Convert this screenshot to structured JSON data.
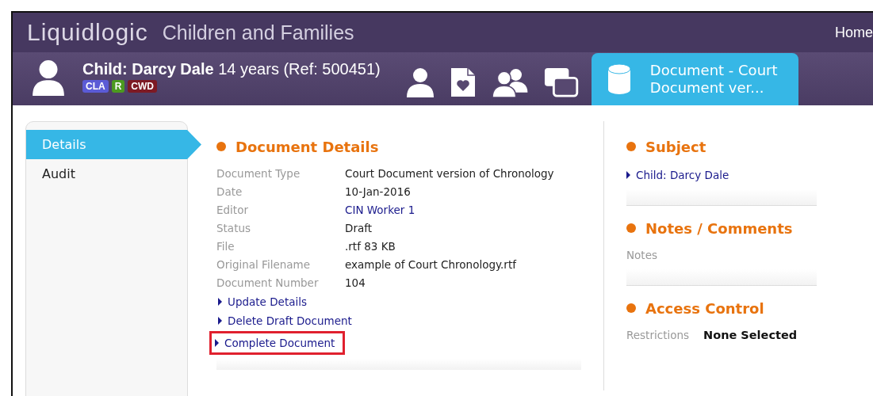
{
  "app_bar": {
    "logo": "Liquidlogic",
    "title": "Children and Families",
    "nav_link": "Home"
  },
  "subject_bar": {
    "name": "Child: Darcy Dale",
    "details": "14 years (Ref: 500451)",
    "badges": [
      {
        "label": "CLA",
        "color": "#5b5bd6"
      },
      {
        "label": "R",
        "color": "#4c9a1f"
      },
      {
        "label": "CWD",
        "color": "#7d1a24"
      }
    ],
    "tabs": [
      {
        "kind": "person",
        "selected": false
      },
      {
        "kind": "document",
        "selected": false
      },
      {
        "kind": "people",
        "selected": false
      },
      {
        "kind": "windows",
        "selected": false
      },
      {
        "kind": "database",
        "label_lines": [
          "Document - Court",
          "Document ver..."
        ],
        "selected": true
      }
    ]
  },
  "sidebar": {
    "items": [
      {
        "label": "Details",
        "selected": true
      },
      {
        "label": "Audit",
        "selected": false
      }
    ]
  },
  "document_details": {
    "heading": "Document Details",
    "fields": [
      {
        "label": "Document Type",
        "value": "Court Document version of Chronology",
        "kind": "text"
      },
      {
        "label": "Date",
        "value": "10-Jan-2016",
        "kind": "text"
      },
      {
        "label": "Editor",
        "value": "CIN Worker 1",
        "kind": "link"
      },
      {
        "label": "Status",
        "value": "Draft",
        "kind": "text"
      },
      {
        "label": "File",
        "value": ".rtf 83 KB",
        "kind": "text"
      },
      {
        "label": "Original Filename",
        "value": "example of Court Chronology.rtf",
        "kind": "text"
      },
      {
        "label": "Document Number",
        "value": "104",
        "kind": "text"
      }
    ],
    "actions": [
      {
        "label": "Update Details",
        "highlighted": false
      },
      {
        "label": "Delete Draft Document",
        "highlighted": false
      },
      {
        "label": "Complete Document",
        "highlighted": true
      }
    ]
  },
  "subject": {
    "heading": "Subject",
    "link": "Child: Darcy Dale"
  },
  "notes": {
    "heading": "Notes / Comments",
    "label": "Notes"
  },
  "access_control": {
    "heading": "Access Control",
    "label": "Restrictions",
    "value": "None Selected"
  }
}
